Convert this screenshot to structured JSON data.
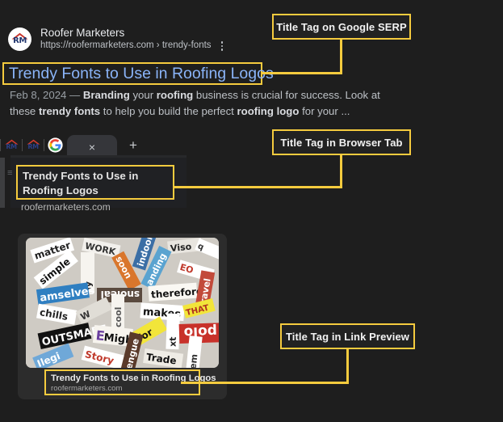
{
  "page": {
    "background_color": "#1e1e1e",
    "accent_color": "#f5cb3e",
    "link_color": "#8ab4f8"
  },
  "serp_result": {
    "site_name": "Roofer Marketers",
    "url": "https://roofermarketers.com › trendy-fonts",
    "favicon_monogram": "RM",
    "kebab_menu_label": "More options",
    "title": "Trendy Fonts to Use in Roofing Logos",
    "snippet": {
      "date": "Feb 8, 2024 — ",
      "parts": [
        {
          "text": "Branding",
          "bold": true
        },
        {
          "text": " your ",
          "bold": false
        },
        {
          "text": "roofing",
          "bold": true
        },
        {
          "text": " business is crucial for success. Look at these ",
          "bold": false
        },
        {
          "text": "trendy fonts",
          "bold": true
        },
        {
          "text": " to help you build the perfect ",
          "bold": false
        },
        {
          "text": "roofing logo",
          "bold": true
        },
        {
          "text": " for your ...",
          "bold": false
        }
      ]
    }
  },
  "browser": {
    "pinned_tabs": [
      {
        "favicon_monogram": "RM"
      },
      {
        "favicon_monogram": "RM"
      },
      {
        "favicon": "google-g-icon"
      }
    ],
    "active_tab": {
      "close_label": "×"
    },
    "new_tab_label": "+",
    "tooltip": {
      "title": "Trendy Fonts to Use in Roofing Logos",
      "domain": "roofermarketers.com"
    }
  },
  "link_preview": {
    "title": "Trendy Fonts to Use in Roofing Logos",
    "domain": "roofermarketers.com",
    "thumbnail_alt": "magazine-word-clippings-collage"
  },
  "callouts": [
    {
      "id": "serp",
      "label": "Title Tag on Google SERP"
    },
    {
      "id": "tab",
      "label": "Title Tag in Browser Tab"
    },
    {
      "id": "preview",
      "label": "Title Tag in Link Preview"
    }
  ]
}
